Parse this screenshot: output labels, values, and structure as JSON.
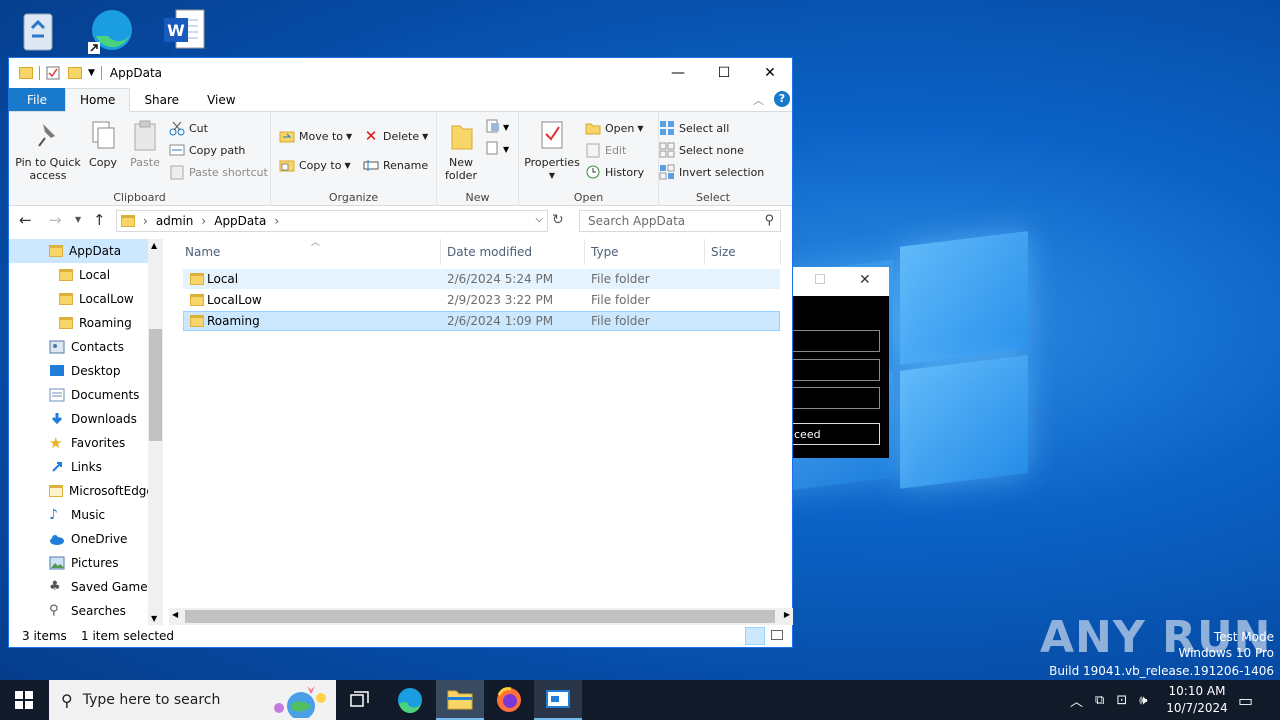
{
  "desktop": {
    "icons": [
      "recycle-bin-icon",
      "edge-icon",
      "word-icon"
    ],
    "watermark": {
      "brand": "ANY RUN",
      "line1": "Test Mode",
      "line2": "Windows 10 Pro",
      "line3": "Build 19041.vb_release.191206-1406"
    }
  },
  "window": {
    "title": "AppData",
    "controls": {
      "minimize": "—",
      "maximize": "☐",
      "close": "✕"
    },
    "tabs": [
      "File",
      "Home",
      "Share",
      "View"
    ],
    "active_tab": "Home",
    "ribbon": {
      "clipboard": {
        "label": "Clipboard",
        "pin": "Pin to Quick access",
        "copy": "Copy",
        "paste": "Paste",
        "cut": "Cut",
        "copy_path": "Copy path",
        "paste_shortcut": "Paste shortcut"
      },
      "organize": {
        "label": "Organize",
        "move_to": "Move to",
        "copy_to": "Copy to",
        "delete": "Delete",
        "rename": "Rename"
      },
      "new": {
        "label": "New",
        "new_folder": "New folder"
      },
      "open": {
        "label": "Open",
        "properties": "Properties",
        "open": "Open",
        "edit": "Edit",
        "history": "History"
      },
      "select": {
        "label": "Select",
        "select_all": "Select all",
        "select_none": "Select none",
        "invert": "Invert selection"
      }
    },
    "address": {
      "crumbs": [
        "admin",
        "AppData"
      ]
    },
    "search": {
      "placeholder": "Search AppData"
    },
    "nav_items": [
      "AppData",
      "Local",
      "LocalLow",
      "Roaming",
      "Contacts",
      "Desktop",
      "Documents",
      "Downloads",
      "Favorites",
      "Links",
      "MicrosoftEdge",
      "Music",
      "OneDrive",
      "Pictures",
      "Saved Games",
      "Searches"
    ],
    "columns": [
      "Name",
      "Date modified",
      "Type",
      "Size"
    ],
    "rows": [
      {
        "name": "Local",
        "date": "2/6/2024 5:24 PM",
        "type": "File folder",
        "size": ""
      },
      {
        "name": "LocalLow",
        "date": "2/9/2023 3:22 PM",
        "type": "File folder",
        "size": ""
      },
      {
        "name": "Roaming",
        "date": "2/6/2024 1:09 PM",
        "type": "File folder",
        "size": ""
      }
    ],
    "status": {
      "count": "3 items",
      "selected": "1 item selected"
    }
  },
  "dialog": {
    "button_fragment": "ceed"
  },
  "taskbar": {
    "search_placeholder": "Type here to search",
    "time": "10:10 AM",
    "date": "10/7/2024"
  }
}
